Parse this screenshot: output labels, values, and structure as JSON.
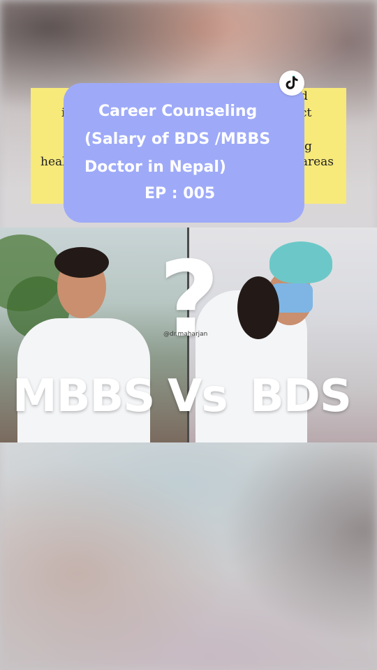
{
  "background_panel": {
    "lines": [
      {
        "text": "d"
      },
      {
        "text": "i"
      },
      {
        "text": "ct"
      },
      {
        "text": "g"
      },
      {
        "text": "heal"
      },
      {
        "text": "l areas"
      }
    ]
  },
  "title_card": {
    "line1": "Career Counseling",
    "line2": "(Salary of BDS /MBBS",
    "line3": "Doctor in Nepal)",
    "line4": "EP : 005"
  },
  "thumbnail": {
    "left_label": "MBBS",
    "middle_label": "Vs",
    "right_label": "BDS",
    "question_mark": "?",
    "watermark": "@dr.maharjan"
  },
  "icons": {
    "tiktok": "tiktok-logo-icon"
  },
  "colors": {
    "title_card_bg": "#9eaaf8",
    "panel_bg": "#f7e97a",
    "label_text": "#ffffff"
  }
}
